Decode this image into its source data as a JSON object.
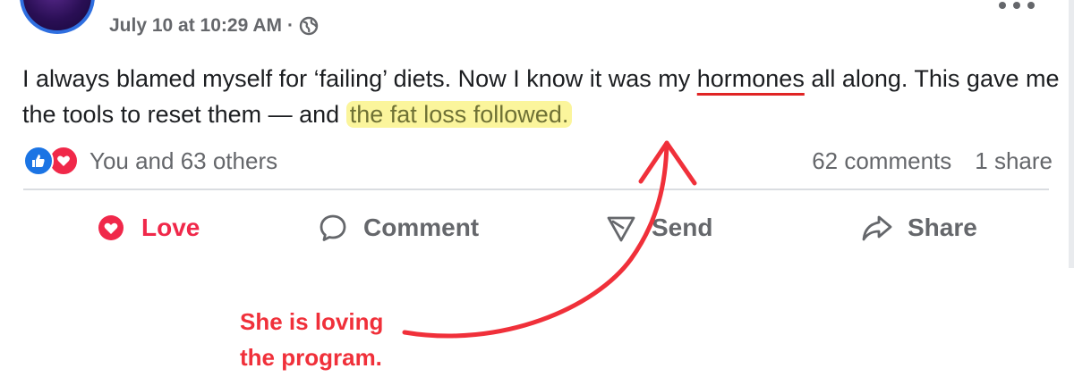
{
  "post": {
    "timestamp": "July 10 at 10:29 AM",
    "separator": "·",
    "privacy_icon": "globe-icon",
    "more_icon": "more-horizontal-icon",
    "text_part1": "I always blamed myself for ‘failing’ diets. Now I know it was my ",
    "text_underlined": "hormones",
    "text_part2": " all along. This gave me the tools to reset them — and ",
    "text_highlighted": "the fat loss followed."
  },
  "reactions": {
    "icons": [
      "like-reaction-icon",
      "love-reaction-icon"
    ],
    "label": "You and 63 others",
    "comments": "62 comments",
    "shares": "1 share"
  },
  "actions": {
    "love": "Love",
    "comment": "Comment",
    "send": "Send",
    "share": "Share"
  },
  "annotation": {
    "line1": "She is loving",
    "line2": "the program."
  },
  "colors": {
    "love_red": "#f0284a",
    "like_blue": "#1b74e4",
    "highlight_yellow": "#fbf59c",
    "annotation_red": "#f0303a",
    "muted_text": "#65676b"
  }
}
